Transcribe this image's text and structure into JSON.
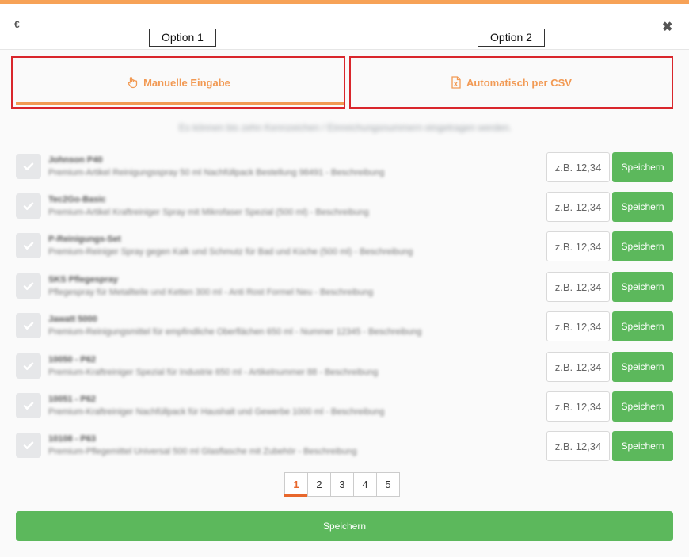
{
  "header": {
    "currency": "€",
    "close": "✖",
    "option_labels": [
      "Option 1",
      "Option 2"
    ]
  },
  "tabs": [
    {
      "label": "Manuelle Eingabe",
      "icon": "hand-pointer-icon",
      "active": true
    },
    {
      "label": "Automatisch per CSV",
      "icon": "file-excel-icon",
      "active": false
    }
  ],
  "info_text": "Es können bis zehn Kennzeichen / Einreichungsnummern eingetragen werden.",
  "rows": [
    {
      "name": "Johnson P40",
      "desc": "Premium-Artikel Reinigungsspray 50 ml Nachfüllpack Bestellung 98491 - Beschreibung",
      "input_placeholder": "z.B. 12,34",
      "button": "Speichern"
    },
    {
      "name": "Tec2Go-Basic",
      "desc": "Premium-Artikel Kraftreiniger Spray mit Mikrofaser Spezial (500 ml) - Beschreibung",
      "input_placeholder": "z.B. 12,34",
      "button": "Speichern"
    },
    {
      "name": "P-Reinigungs-Set",
      "desc": "Premium-Reiniger Spray gegen Kalk und Schmutz für Bad und Küche (500 ml) - Beschreibung",
      "input_placeholder": "z.B. 12,34",
      "button": "Speichern"
    },
    {
      "name": "SKS Pflegespray",
      "desc": "Pflegespray für Metallteile und Ketten 300 ml - Anti Rost Formel Neu - Beschreibung",
      "input_placeholder": "z.B. 12,34",
      "button": "Speichern"
    },
    {
      "name": "Jawatt 5000",
      "desc": "Premium-Reinigungsmittel für empfindliche Oberflächen 650 ml - Nummer 12345 - Beschreibung",
      "input_placeholder": "z.B. 12,34",
      "button": "Speichern"
    },
    {
      "name": "10050 - P62",
      "desc": "Premium-Kraftreiniger Spezial für Industrie 650 ml - Artikelnummer 88 - Beschreibung",
      "input_placeholder": "z.B. 12,34",
      "button": "Speichern"
    },
    {
      "name": "10051 - P62",
      "desc": "Premium-Kraftreiniger Nachfüllpack für Haushalt und Gewerbe 1000 ml - Beschreibung",
      "input_placeholder": "z.B. 12,34",
      "button": "Speichern"
    },
    {
      "name": "10108 - P63",
      "desc": "Premium-Pflegemittel Universal 500 ml Glasflasche mit Zubehör - Beschreibung",
      "input_placeholder": "z.B. 12,34",
      "button": "Speichern"
    }
  ],
  "pagination": {
    "pages": [
      "1",
      "2",
      "3",
      "4",
      "5"
    ],
    "current": "1"
  },
  "footer": {
    "save_label": "Speichern"
  },
  "colors": {
    "accent": "#f29a54",
    "success": "#5cb85c",
    "highlight_border": "#d9262c",
    "page_active": "#e8672c"
  }
}
